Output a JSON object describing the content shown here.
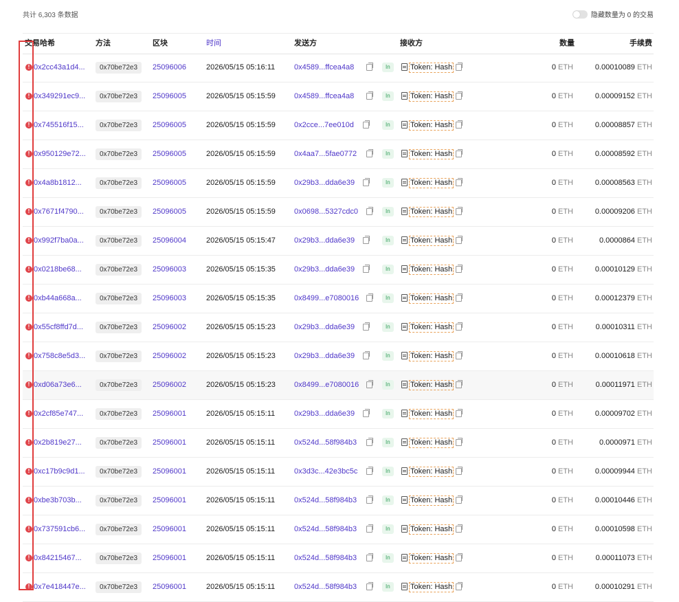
{
  "summary": {
    "total_text": "共计 6,303 条数据",
    "toggle_label": "隐藏数量为 0 的交易"
  },
  "columns": {
    "hash": "交易哈希",
    "method": "方法",
    "block": "区块",
    "time": "时间",
    "from": "发送方",
    "to": "接收方",
    "amount": "数量",
    "fee": "手续费"
  },
  "rows": [
    {
      "hash": "0x2cc43a1d4...",
      "method": "0x70be72e3",
      "block": "25096006",
      "time": "2026/05/15 05:16:11",
      "from": "0x4589...ffcea4a8",
      "dir": "In",
      "to": "Token: Hash",
      "amount": "0",
      "unit": "ETH",
      "fee": "0.00010089"
    },
    {
      "hash": "0x349291ec9...",
      "method": "0x70be72e3",
      "block": "25096005",
      "time": "2026/05/15 05:15:59",
      "from": "0x4589...ffcea4a8",
      "dir": "In",
      "to": "Token: Hash",
      "amount": "0",
      "unit": "ETH",
      "fee": "0.00009152"
    },
    {
      "hash": "0x745516f15...",
      "method": "0x70be72e3",
      "block": "25096005",
      "time": "2026/05/15 05:15:59",
      "from": "0x2cce...7ee010d",
      "dir": "In",
      "to": "Token: Hash",
      "amount": "0",
      "unit": "ETH",
      "fee": "0.00008857"
    },
    {
      "hash": "0x950129e72...",
      "method": "0x70be72e3",
      "block": "25096005",
      "time": "2026/05/15 05:15:59",
      "from": "0x4aa7...5fae0772",
      "dir": "In",
      "to": "Token: Hash",
      "amount": "0",
      "unit": "ETH",
      "fee": "0.00008592"
    },
    {
      "hash": "0x4a8b1812...",
      "method": "0x70be72e3",
      "block": "25096005",
      "time": "2026/05/15 05:15:59",
      "from": "0x29b3...dda6e39",
      "dir": "In",
      "to": "Token: Hash",
      "amount": "0",
      "unit": "ETH",
      "fee": "0.00008563"
    },
    {
      "hash": "0x7671f4790...",
      "method": "0x70be72e3",
      "block": "25096005",
      "time": "2026/05/15 05:15:59",
      "from": "0x0698...5327cdc0",
      "dir": "In",
      "to": "Token: Hash",
      "amount": "0",
      "unit": "ETH",
      "fee": "0.00009206"
    },
    {
      "hash": "0x992f7ba0a...",
      "method": "0x70be72e3",
      "block": "25096004",
      "time": "2026/05/15 05:15:47",
      "from": "0x29b3...dda6e39",
      "dir": "In",
      "to": "Token: Hash",
      "amount": "0",
      "unit": "ETH",
      "fee": "0.0000864"
    },
    {
      "hash": "0x0218be68...",
      "method": "0x70be72e3",
      "block": "25096003",
      "time": "2026/05/15 05:15:35",
      "from": "0x29b3...dda6e39",
      "dir": "In",
      "to": "Token: Hash",
      "amount": "0",
      "unit": "ETH",
      "fee": "0.00010129"
    },
    {
      "hash": "0xb44a668a...",
      "method": "0x70be72e3",
      "block": "25096003",
      "time": "2026/05/15 05:15:35",
      "from": "0x8499...e7080016",
      "dir": "In",
      "to": "Token: Hash",
      "amount": "0",
      "unit": "ETH",
      "fee": "0.00012379"
    },
    {
      "hash": "0x55cf8ffd7d...",
      "method": "0x70be72e3",
      "block": "25096002",
      "time": "2026/05/15 05:15:23",
      "from": "0x29b3...dda6e39",
      "dir": "In",
      "to": "Token: Hash",
      "amount": "0",
      "unit": "ETH",
      "fee": "0.00010311"
    },
    {
      "hash": "0x758c8e5d3...",
      "method": "0x70be72e3",
      "block": "25096002",
      "time": "2026/05/15 05:15:23",
      "from": "0x29b3...dda6e39",
      "dir": "In",
      "to": "Token: Hash",
      "amount": "0",
      "unit": "ETH",
      "fee": "0.00010618"
    },
    {
      "hash": "0xd06a73e6...",
      "method": "0x70be72e3",
      "block": "25096002",
      "time": "2026/05/15 05:15:23",
      "from": "0x8499...e7080016",
      "dir": "In",
      "to": "Token: Hash",
      "amount": "0",
      "unit": "ETH",
      "fee": "0.00011971"
    },
    {
      "hash": "0x2cf85e747...",
      "method": "0x70be72e3",
      "block": "25096001",
      "time": "2026/05/15 05:15:11",
      "from": "0x29b3...dda6e39",
      "dir": "In",
      "to": "Token: Hash",
      "amount": "0",
      "unit": "ETH",
      "fee": "0.00009702"
    },
    {
      "hash": "0x2b819e27...",
      "method": "0x70be72e3",
      "block": "25096001",
      "time": "2026/05/15 05:15:11",
      "from": "0x524d...58f984b3",
      "dir": "In",
      "to": "Token: Hash",
      "amount": "0",
      "unit": "ETH",
      "fee": "0.0000971"
    },
    {
      "hash": "0xc17b9c9d1...",
      "method": "0x70be72e3",
      "block": "25096001",
      "time": "2026/05/15 05:15:11",
      "from": "0x3d3c...42e3bc5c",
      "dir": "In",
      "to": "Token: Hash",
      "amount": "0",
      "unit": "ETH",
      "fee": "0.00009944"
    },
    {
      "hash": "0xbe3b703b...",
      "method": "0x70be72e3",
      "block": "25096001",
      "time": "2026/05/15 05:15:11",
      "from": "0x524d...58f984b3",
      "dir": "In",
      "to": "Token: Hash",
      "amount": "0",
      "unit": "ETH",
      "fee": "0.00010446"
    },
    {
      "hash": "0x737591cb6...",
      "method": "0x70be72e3",
      "block": "25096001",
      "time": "2026/05/15 05:15:11",
      "from": "0x524d...58f984b3",
      "dir": "In",
      "to": "Token: Hash",
      "amount": "0",
      "unit": "ETH",
      "fee": "0.00010598"
    },
    {
      "hash": "0x84215467...",
      "method": "0x70be72e3",
      "block": "25096001",
      "time": "2026/05/15 05:15:11",
      "from": "0x524d...58f984b3",
      "dir": "In",
      "to": "Token: Hash",
      "amount": "0",
      "unit": "ETH",
      "fee": "0.00011073"
    },
    {
      "hash": "0x7e418447e...",
      "method": "0x70be72e3",
      "block": "25096001",
      "time": "2026/05/15 05:15:11",
      "from": "0x524d...58f984b3",
      "dir": "In",
      "to": "Token: Hash",
      "amount": "0",
      "unit": "ETH",
      "fee": "0.00010291"
    }
  ],
  "highlighted_row": 11,
  "colors": {
    "link": "#4f37c9",
    "error": "#e0454b",
    "in_badge": "#2f9e57",
    "annotation_box": "#e03c3c"
  }
}
